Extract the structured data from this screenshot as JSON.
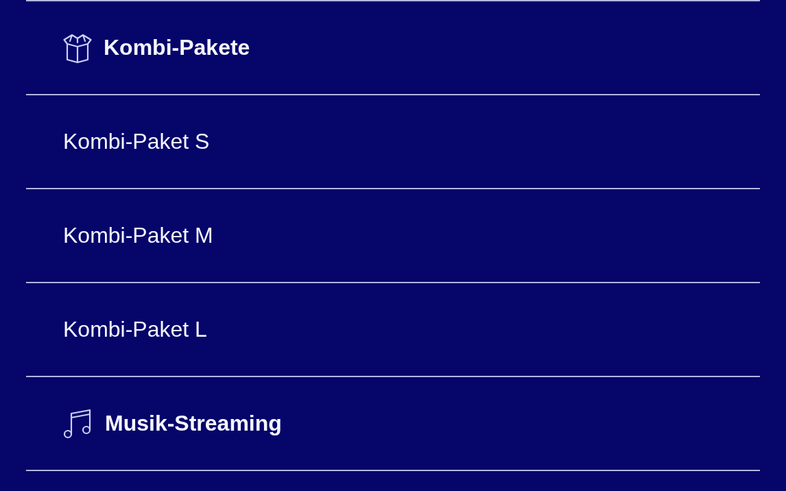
{
  "menu": {
    "items": [
      {
        "kind": "category",
        "label": "Kombi-Pakete"
      },
      {
        "kind": "item",
        "label": "Kombi-Paket S"
      },
      {
        "kind": "item",
        "label": "Kombi-Paket M"
      },
      {
        "kind": "item",
        "label": "Kombi-Paket L"
      },
      {
        "kind": "category",
        "label": "Musik-Streaming"
      }
    ]
  }
}
